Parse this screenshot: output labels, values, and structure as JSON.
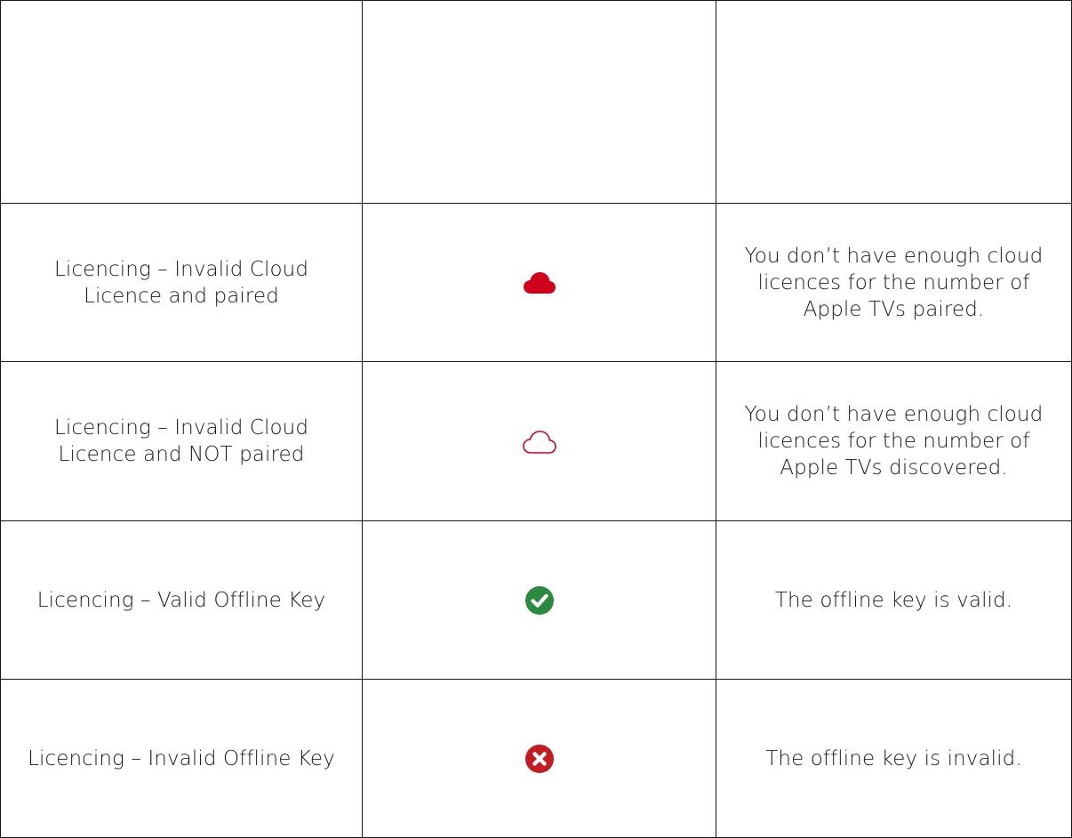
{
  "table": {
    "rows": [
      {
        "status": "",
        "icon": "",
        "description": ""
      },
      {
        "status": "Licencing – Invalid Cloud Licence and paired",
        "icon": "cloud-filled-red-icon",
        "description": "You don’t have enough cloud licences for the number of Apple TVs paired."
      },
      {
        "status": "Licencing – Invalid Cloud Licence and NOT paired",
        "icon": "cloud-outline-red-icon",
        "description": "You don’t have enough cloud licences for the number of Apple TVs discovered."
      },
      {
        "status": "Licencing – Valid Offline Key",
        "icon": "check-circle-green-icon",
        "description": "The offline key is valid."
      },
      {
        "status": "Licencing – Invalid Offline Key",
        "icon": "x-circle-red-icon",
        "description": "The offline key is invalid."
      }
    ]
  },
  "colors": {
    "cloud_red": "#d0021b",
    "check_green": "#2a8a3e",
    "x_red": "#c41a22",
    "border": "#1a1a1a"
  }
}
